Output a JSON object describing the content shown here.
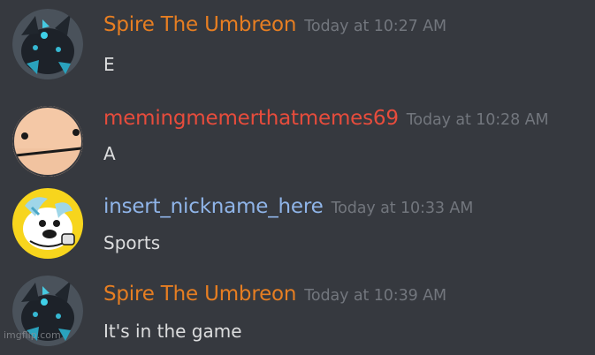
{
  "colors": {
    "background": "#36393f",
    "timestamp": "#72767d",
    "message_text": "#dcddde",
    "spire_name": "#e67e22",
    "meming_name": "#e74c3c",
    "insert_name": "#8fb4e8"
  },
  "messages": [
    {
      "username": "Spire The Umbreon",
      "username_color": "#e67e22",
      "timestamp": "Today at 10:27 AM",
      "content": "E",
      "avatar_icon": "umbreon-avatar-icon"
    },
    {
      "username": "memingmemerthatmemes69",
      "username_color": "#e74c3c",
      "timestamp": "Today at 10:28 AM",
      "content": "A",
      "avatar_icon": "bald-face-avatar-icon"
    },
    {
      "username": "insert_nickname_here",
      "username_color": "#8fb4e8",
      "timestamp": "Today at 10:33 AM",
      "content": "Sports",
      "avatar_icon": "cartoon-avatar-icon"
    },
    {
      "username": "Spire The Umbreon",
      "username_color": "#e67e22",
      "timestamp": "Today at 10:39 AM",
      "content": "It's in the game",
      "avatar_icon": "umbreon-avatar-icon"
    }
  ],
  "watermark": "imgflip.com"
}
